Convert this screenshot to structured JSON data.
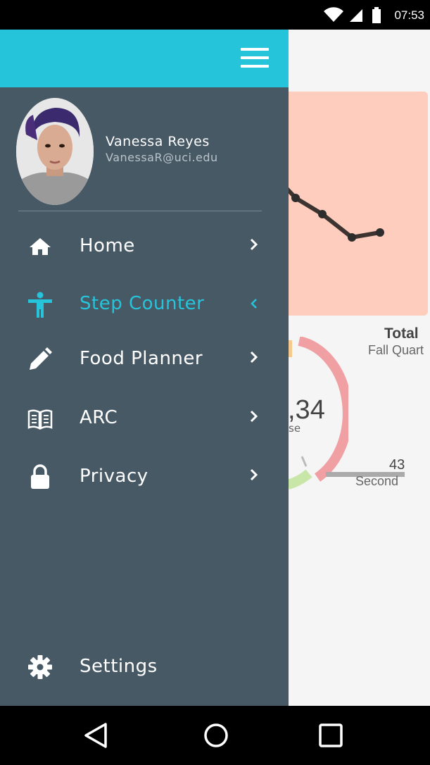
{
  "status_bar": {
    "time": "07:53",
    "icons": [
      "wifi-icon",
      "cell-signal-icon",
      "battery-icon"
    ]
  },
  "drawer": {
    "header_color": "#25c4da",
    "background_color": "#485966",
    "menu_icon": "hamburger-menu-icon",
    "user": {
      "name": "Vanessa Reyes",
      "email": "VanessaR@uci.edu"
    },
    "items": [
      {
        "label": "Home",
        "icon": "home-icon",
        "active": false
      },
      {
        "label": "Step Counter",
        "icon": "accessibility-person-icon",
        "active": true
      },
      {
        "label": "Food Planner",
        "icon": "pencil-icon",
        "active": false
      },
      {
        "label": "ARC",
        "icon": "open-book-icon",
        "active": false
      },
      {
        "label": "Privacy",
        "icon": "lock-icon",
        "active": false
      }
    ],
    "settings": {
      "label": "Settings",
      "icon": "gear-icon"
    }
  },
  "background": {
    "total_label": "Total",
    "quarter_label": "Fall Quart",
    "big_value": ",34",
    "big_unit": "se",
    "seconds_value": "43",
    "seconds_label": "Second",
    "chart_color": "#ffcdbd"
  },
  "nav_bar": {
    "icons": [
      "back-icon",
      "home-circle-icon",
      "recents-square-icon"
    ]
  }
}
